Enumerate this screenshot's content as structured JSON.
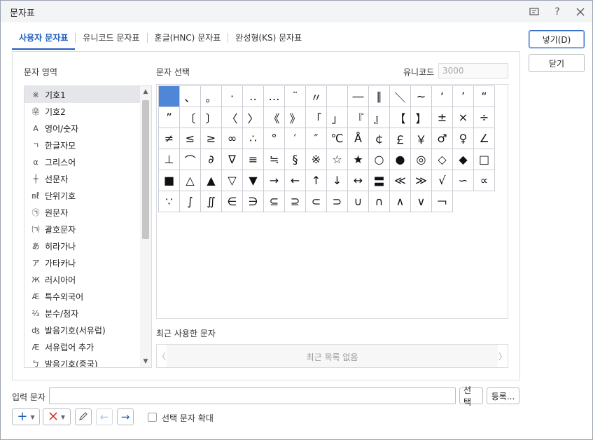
{
  "window": {
    "title": "문자표"
  },
  "titlebar_icons": [
    "help-panel-icon",
    "help-icon",
    "close-icon"
  ],
  "tabs": [
    {
      "label": "사용자 문자표",
      "active": true
    },
    {
      "label": "유니코드 문자표",
      "active": false
    },
    {
      "label": "훈글(HNC) 문자표",
      "active": false
    },
    {
      "label": "완성형(KS) 문자표",
      "active": false
    }
  ],
  "buttons": {
    "insert": "넣기(D)",
    "close": "닫기",
    "select": "선택",
    "register": "등록..."
  },
  "labels": {
    "char_area": "문자 영역",
    "char_select": "문자 선택",
    "unicode": "유니코드",
    "recent": "최근 사용한 문자",
    "input_char": "입력 문자",
    "enlarge": "선택 문자 확대"
  },
  "unicode_value": "3000",
  "recent_empty": "최근 목록 없음",
  "categories": [
    {
      "icon": "※",
      "label": "기호1",
      "selected": true
    },
    {
      "icon": "㉾",
      "label": "기호2"
    },
    {
      "icon": "A",
      "label": "영어/숫자"
    },
    {
      "icon": "ㄱ",
      "label": "한글자모"
    },
    {
      "icon": "α",
      "label": "그리스어"
    },
    {
      "icon": "┼",
      "label": "선문자"
    },
    {
      "icon": "㎖",
      "label": "단위기호"
    },
    {
      "icon": "㉠",
      "label": "원문자"
    },
    {
      "icon": "㈀",
      "label": "괄호문자"
    },
    {
      "icon": "あ",
      "label": "히라가나"
    },
    {
      "icon": "ア",
      "label": "가타카나"
    },
    {
      "icon": "Ж",
      "label": "러시아어"
    },
    {
      "icon": "Æ",
      "label": "특수외국어"
    },
    {
      "icon": "⅔",
      "label": "분수/첨자"
    },
    {
      "icon": "ʤ",
      "label": "발음기호(서유럽)"
    },
    {
      "icon": "Æ",
      "label": "서유럽어 추가"
    },
    {
      "icon": "ㄅ",
      "label": "발음기호(중국)"
    }
  ],
  "characters": [
    "",
    "、",
    "。",
    "·",
    "‥",
    "…",
    "¨",
    "〃",
    "­",
    "―",
    "∥",
    "＼",
    "∼",
    "‘",
    "’",
    "“",
    "”",
    "〔",
    "〕",
    "〈",
    "〉",
    "《",
    "》",
    "「",
    "」",
    "『",
    "』",
    "【",
    "】",
    "±",
    "×",
    "÷",
    "≠",
    "≤",
    "≥",
    "∞",
    "∴",
    "°",
    "′",
    "″",
    "℃",
    "Å",
    "￠",
    "￡",
    "￥",
    "♂",
    "♀",
    "∠",
    "⊥",
    "⌒",
    "∂",
    "∇",
    "≡",
    "≒",
    "§",
    "※",
    "☆",
    "★",
    "○",
    "●",
    "◎",
    "◇",
    "◆",
    "□",
    "■",
    "△",
    "▲",
    "▽",
    "▼",
    "→",
    "←",
    "↑",
    "↓",
    "↔",
    "〓",
    "≪",
    "≫",
    "√",
    "∽",
    "∝",
    "∵",
    "∫",
    "∬",
    "∈",
    "∋",
    "⊆",
    "⊇",
    "⊂",
    "⊃",
    "∪",
    "∩",
    "∧",
    "∨",
    "￢"
  ]
}
